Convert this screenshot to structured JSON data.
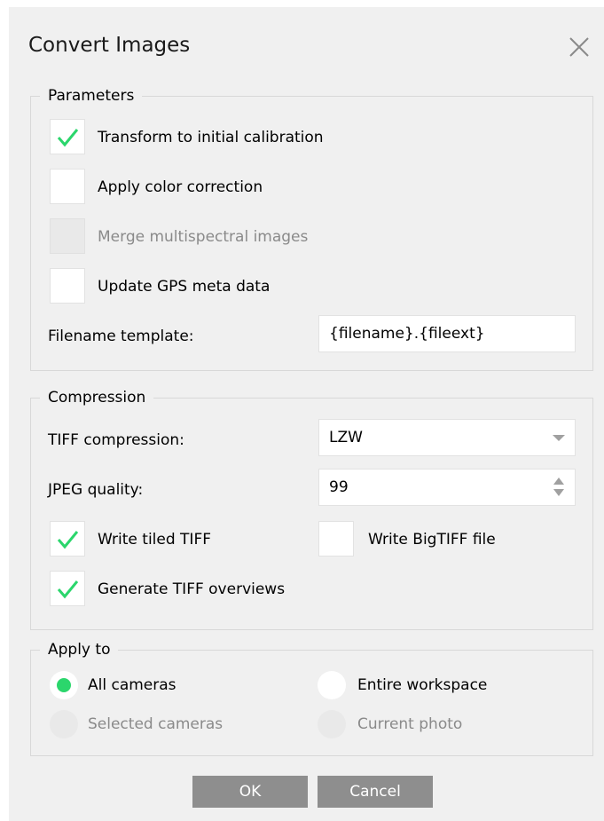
{
  "dialog": {
    "title": "Convert Images",
    "close_icon": "close-icon"
  },
  "parameters": {
    "legend": "Parameters",
    "options": [
      {
        "label": "Transform to initial calibration",
        "checked": true,
        "enabled": true
      },
      {
        "label": "Apply color correction",
        "checked": false,
        "enabled": true
      },
      {
        "label": "Merge multispectral images",
        "checked": false,
        "enabled": false
      },
      {
        "label": "Update GPS meta data",
        "checked": false,
        "enabled": true
      }
    ],
    "filename_template_label": "Filename template:",
    "filename_template_value": "{filename}.{fileext}"
  },
  "compression": {
    "legend": "Compression",
    "tiff_label": "TIFF compression:",
    "tiff_value": "LZW",
    "jpeg_label": "JPEG quality:",
    "jpeg_value": "99",
    "write_tiled": {
      "label": "Write tiled TIFF",
      "checked": true
    },
    "write_bigtiff": {
      "label": "Write BigTIFF file",
      "checked": false
    },
    "generate_overviews": {
      "label": "Generate TIFF overviews",
      "checked": true
    }
  },
  "apply_to": {
    "legend": "Apply to",
    "all_cameras": {
      "label": "All cameras",
      "selected": true,
      "enabled": true
    },
    "entire_workspace": {
      "label": "Entire workspace",
      "selected": false,
      "enabled": true
    },
    "selected_cameras": {
      "label": "Selected cameras",
      "selected": false,
      "enabled": false
    },
    "current_photo": {
      "label": "Current photo",
      "selected": false,
      "enabled": false
    }
  },
  "buttons": {
    "ok": "OK",
    "cancel": "Cancel"
  },
  "colors": {
    "check_accent": "#2bd66c",
    "dialog_background": "#f0f0f0",
    "button_background": "#8e8e8e",
    "disabled_text": "#8a8a8a"
  }
}
